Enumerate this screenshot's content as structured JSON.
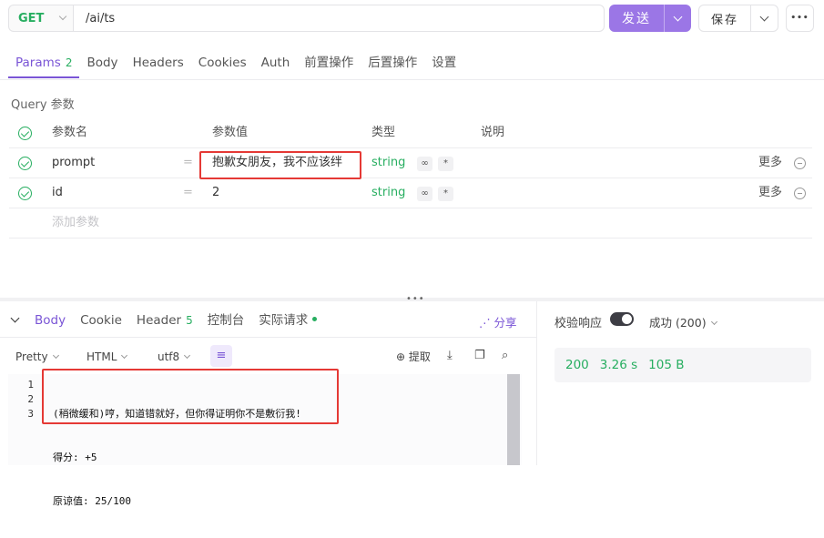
{
  "request": {
    "method": "GET",
    "url": "/ai/ts",
    "send_label": "发送",
    "save_label": "保存",
    "more_label": "•••"
  },
  "request_tabs": [
    {
      "label": "Params",
      "badge": "2",
      "active": true
    },
    {
      "label": "Body"
    },
    {
      "label": "Headers"
    },
    {
      "label": "Cookies"
    },
    {
      "label": "Auth"
    },
    {
      "label": "前置操作"
    },
    {
      "label": "后置操作"
    },
    {
      "label": "设置"
    }
  ],
  "query": {
    "title": "Query 参数",
    "headers": {
      "name": "参数名",
      "value": "参数值",
      "type": "类型",
      "desc": "说明"
    },
    "rows": [
      {
        "name": "prompt",
        "value": "抱歉女朋友，我不应该绊",
        "type": "string",
        "more": "更多"
      },
      {
        "name": "id",
        "value": "2",
        "type": "string",
        "more": "更多"
      }
    ],
    "add_placeholder": "添加参数"
  },
  "response_tabs": [
    {
      "label": "Body",
      "active": true
    },
    {
      "label": "Cookie"
    },
    {
      "label": "Header",
      "badge": "5"
    },
    {
      "label": "控制台"
    },
    {
      "label": "实际请求"
    }
  ],
  "share_label": "分享",
  "format_bar": {
    "pretty": "Pretty",
    "html": "HTML",
    "encoding": "utf8",
    "extract": "提取"
  },
  "code": {
    "line_numbers": [
      "1",
      "2",
      "3"
    ],
    "lines": [
      "(稍微缓和)哼，知道错就好，但你得证明你不是敷衍我!",
      "得分: +5",
      "原谅值: 25/100"
    ]
  },
  "verify": {
    "label": "校验响应",
    "toggle_on": true,
    "result": "成功 (200)"
  },
  "status": {
    "code": "200",
    "time": "3.26 s",
    "size": "105 B"
  }
}
